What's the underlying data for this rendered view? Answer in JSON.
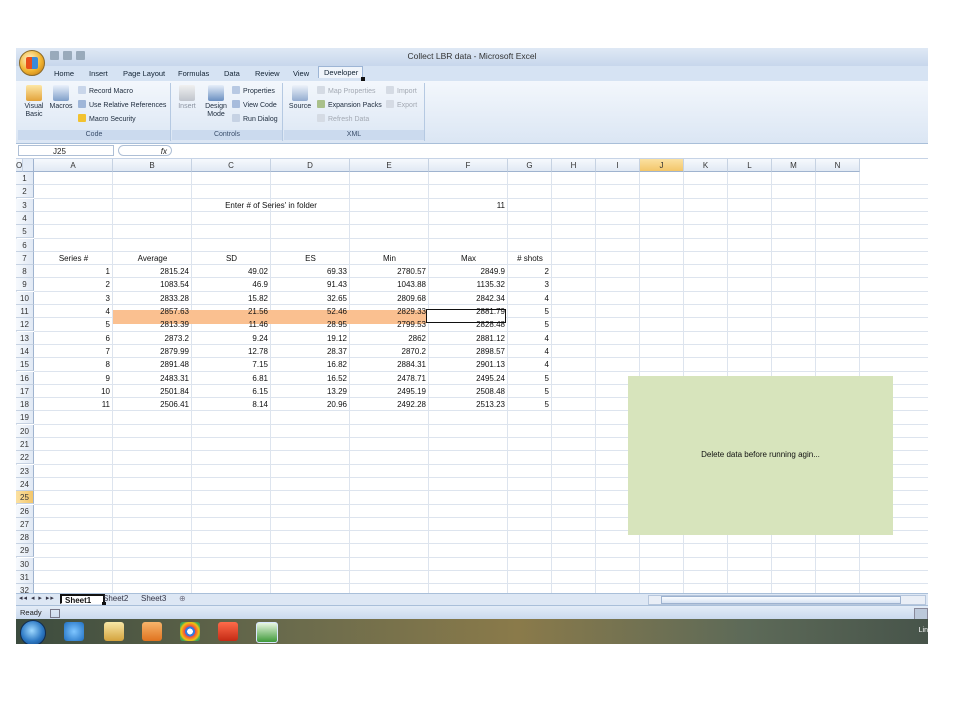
{
  "window": {
    "title": "Collect LBR data - Microsoft Excel"
  },
  "tabs": [
    "Home",
    "Insert",
    "Page Layout",
    "Formulas",
    "Data",
    "Review",
    "View",
    "Developer"
  ],
  "active_tab": "Developer",
  "ribbon": {
    "code": {
      "label": "Code",
      "visual_basic": "Visual Basic",
      "macros": "Macros",
      "record_macro": "Record Macro",
      "use_relative": "Use Relative References",
      "macro_security": "Macro Security"
    },
    "controls": {
      "label": "Controls",
      "insert": "Insert",
      "design_mode": "Design Mode",
      "properties": "Properties",
      "view_code": "View Code",
      "run_dialog": "Run Dialog"
    },
    "xml": {
      "label": "XML",
      "source": "Source",
      "map_properties": "Map Properties",
      "expansion_packs": "Expansion Packs",
      "refresh_data": "Refresh Data",
      "import": "Import",
      "export": "Export"
    }
  },
  "formula_bar": {
    "name_box": "J25",
    "fx": "fx"
  },
  "columns": [
    "A",
    "B",
    "C",
    "D",
    "E",
    "F",
    "G",
    "H",
    "I",
    "J",
    "K",
    "L",
    "M",
    "N",
    "O"
  ],
  "selected_column": "J",
  "rows": [
    "1",
    "2",
    "3",
    "4",
    "5",
    "6",
    "7",
    "8",
    "9",
    "10",
    "11",
    "12",
    "13",
    "14",
    "15",
    "16",
    "17",
    "18",
    "19",
    "20",
    "21",
    "22",
    "23",
    "24",
    "25",
    "26",
    "27",
    "28",
    "29",
    "30",
    "31",
    "32"
  ],
  "selected_row": "25",
  "sheet": {
    "prompt_label": "Enter # of Series' in folder",
    "series_count": "11",
    "headers": [
      "Series #",
      "Average",
      "SD",
      "ES",
      "Min",
      "Max",
      "# shots"
    ],
    "data": [
      [
        "1",
        "2815.24",
        "49.02",
        "69.33",
        "2780.57",
        "2849.9",
        "2"
      ],
      [
        "2",
        "1083.54",
        "46.9",
        "91.43",
        "1043.88",
        "1135.32",
        "3"
      ],
      [
        "3",
        "2833.28",
        "15.82",
        "32.65",
        "2809.68",
        "2842.34",
        "4"
      ],
      [
        "4",
        "2857.63",
        "21.56",
        "52.46",
        "2829.33",
        "2881.79",
        "5"
      ],
      [
        "5",
        "2813.39",
        "11.46",
        "28.95",
        "2799.53",
        "2828.48",
        "5"
      ],
      [
        "6",
        "2873.2",
        "9.24",
        "19.12",
        "2862",
        "2881.12",
        "4"
      ],
      [
        "7",
        "2879.99",
        "12.78",
        "28.37",
        "2870.2",
        "2898.57",
        "4"
      ],
      [
        "8",
        "2891.48",
        "7.15",
        "16.82",
        "2884.31",
        "2901.13",
        "4"
      ],
      [
        "9",
        "2483.31",
        "6.81",
        "16.52",
        "2478.71",
        "2495.24",
        "5"
      ],
      [
        "10",
        "2501.84",
        "6.15",
        "13.29",
        "2495.19",
        "2508.48",
        "5"
      ],
      [
        "11",
        "2506.41",
        "8.14",
        "20.96",
        "2492.28",
        "2513.23",
        "5"
      ]
    ],
    "button_label": "Delete data before running agin..."
  },
  "sheet_tabs": [
    "Sheet1",
    "Sheet2",
    "Sheet3"
  ],
  "active_sheet": "Sheet1",
  "status": {
    "ready": "Ready"
  },
  "tray": {
    "text": "Lin"
  }
}
